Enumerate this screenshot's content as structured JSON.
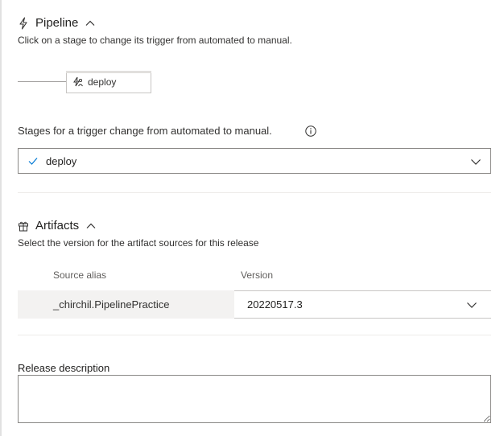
{
  "pipeline": {
    "title": "Pipeline",
    "help": "Click on a stage to change its trigger from automated to manual.",
    "stage_name": "deploy"
  },
  "stages_trigger": {
    "label": "Stages for a trigger change from automated to manual.",
    "selected": "deploy"
  },
  "artifacts": {
    "title": "Artifacts",
    "help": "Select the version for the artifact sources for this release",
    "columns": {
      "source_alias": "Source alias",
      "version": "Version"
    },
    "rows": [
      {
        "source_alias": "_chirchil.PipelinePractice",
        "version": "20220517.3"
      }
    ]
  },
  "release_description": {
    "label": "Release description",
    "value": ""
  },
  "icons": {
    "pipeline": "lightning-icon",
    "stage": "stage-trigger-icon",
    "info": "info-icon",
    "check": "check-icon",
    "artifacts": "gift-icon",
    "collapse": "chevron-up-icon",
    "expand": "chevron-down-icon"
  },
  "colors": {
    "check": "#0078d4",
    "border": "#8a8886",
    "row_bg": "#f3f2f1"
  }
}
